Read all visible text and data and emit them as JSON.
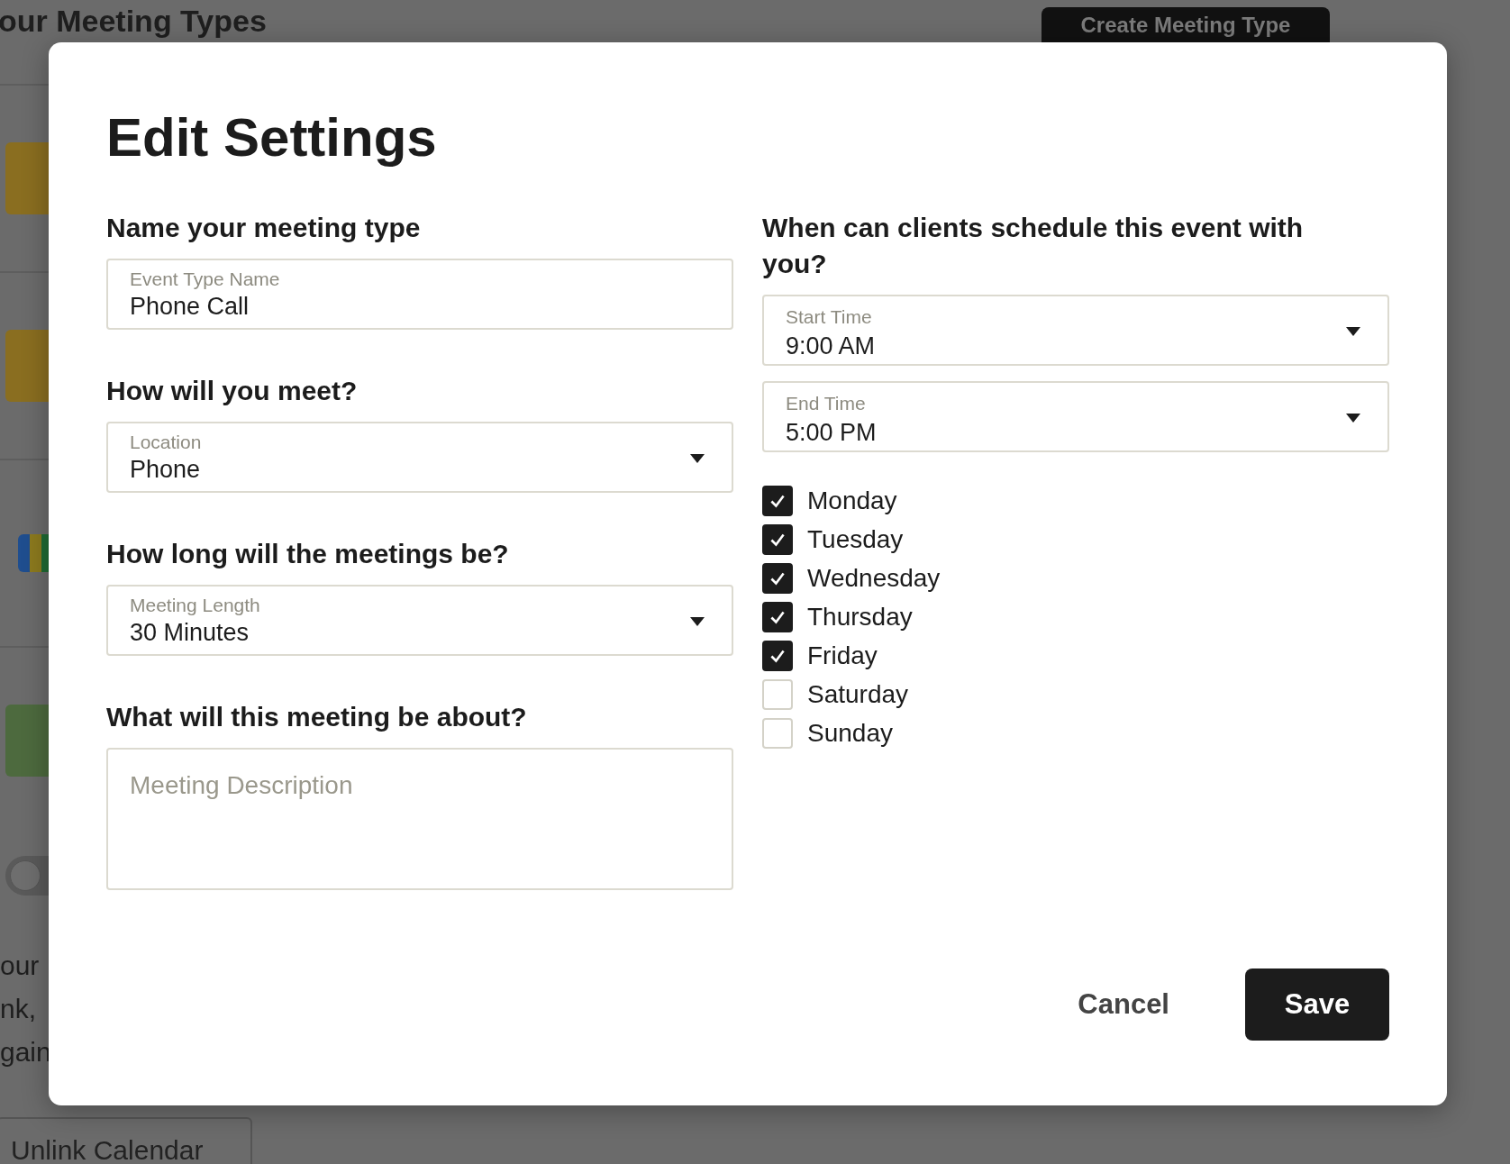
{
  "background": {
    "page_title": "our Meeting Types",
    "create_button": "Create Meeting Type",
    "toggle": {
      "on": false
    },
    "text_lines": [
      "our",
      "nk,",
      "gain"
    ],
    "unlink_button": "Unlink Calendar"
  },
  "dialog": {
    "title": "Edit Settings",
    "left_sections": [
      {
        "heading": "Name your meeting type",
        "kind": "text",
        "label": "Event Type Name",
        "value": "Phone Call"
      },
      {
        "heading": "How will you meet?",
        "kind": "select",
        "label": "Location",
        "value": "Phone"
      },
      {
        "heading": "How long will the meetings be?",
        "kind": "select",
        "label": "Meeting Length",
        "value": "30 Minutes"
      },
      {
        "heading": "What will this meeting be about?",
        "kind": "textarea",
        "placeholder": "Meeting Description"
      }
    ],
    "schedule": {
      "heading": "When can clients schedule this event with you?",
      "fields": [
        {
          "label": "Start Time",
          "value": "9:00 AM"
        },
        {
          "label": "End Time",
          "value": "5:00 PM"
        }
      ],
      "days": [
        {
          "label": "Monday",
          "checked": true
        },
        {
          "label": "Tuesday",
          "checked": true
        },
        {
          "label": "Wednesday",
          "checked": true
        },
        {
          "label": "Thursday",
          "checked": true
        },
        {
          "label": "Friday",
          "checked": true
        },
        {
          "label": "Saturday",
          "checked": false
        },
        {
          "label": "Sunday",
          "checked": false
        }
      ]
    },
    "buttons": {
      "cancel": "Cancel",
      "save": "Save"
    }
  }
}
